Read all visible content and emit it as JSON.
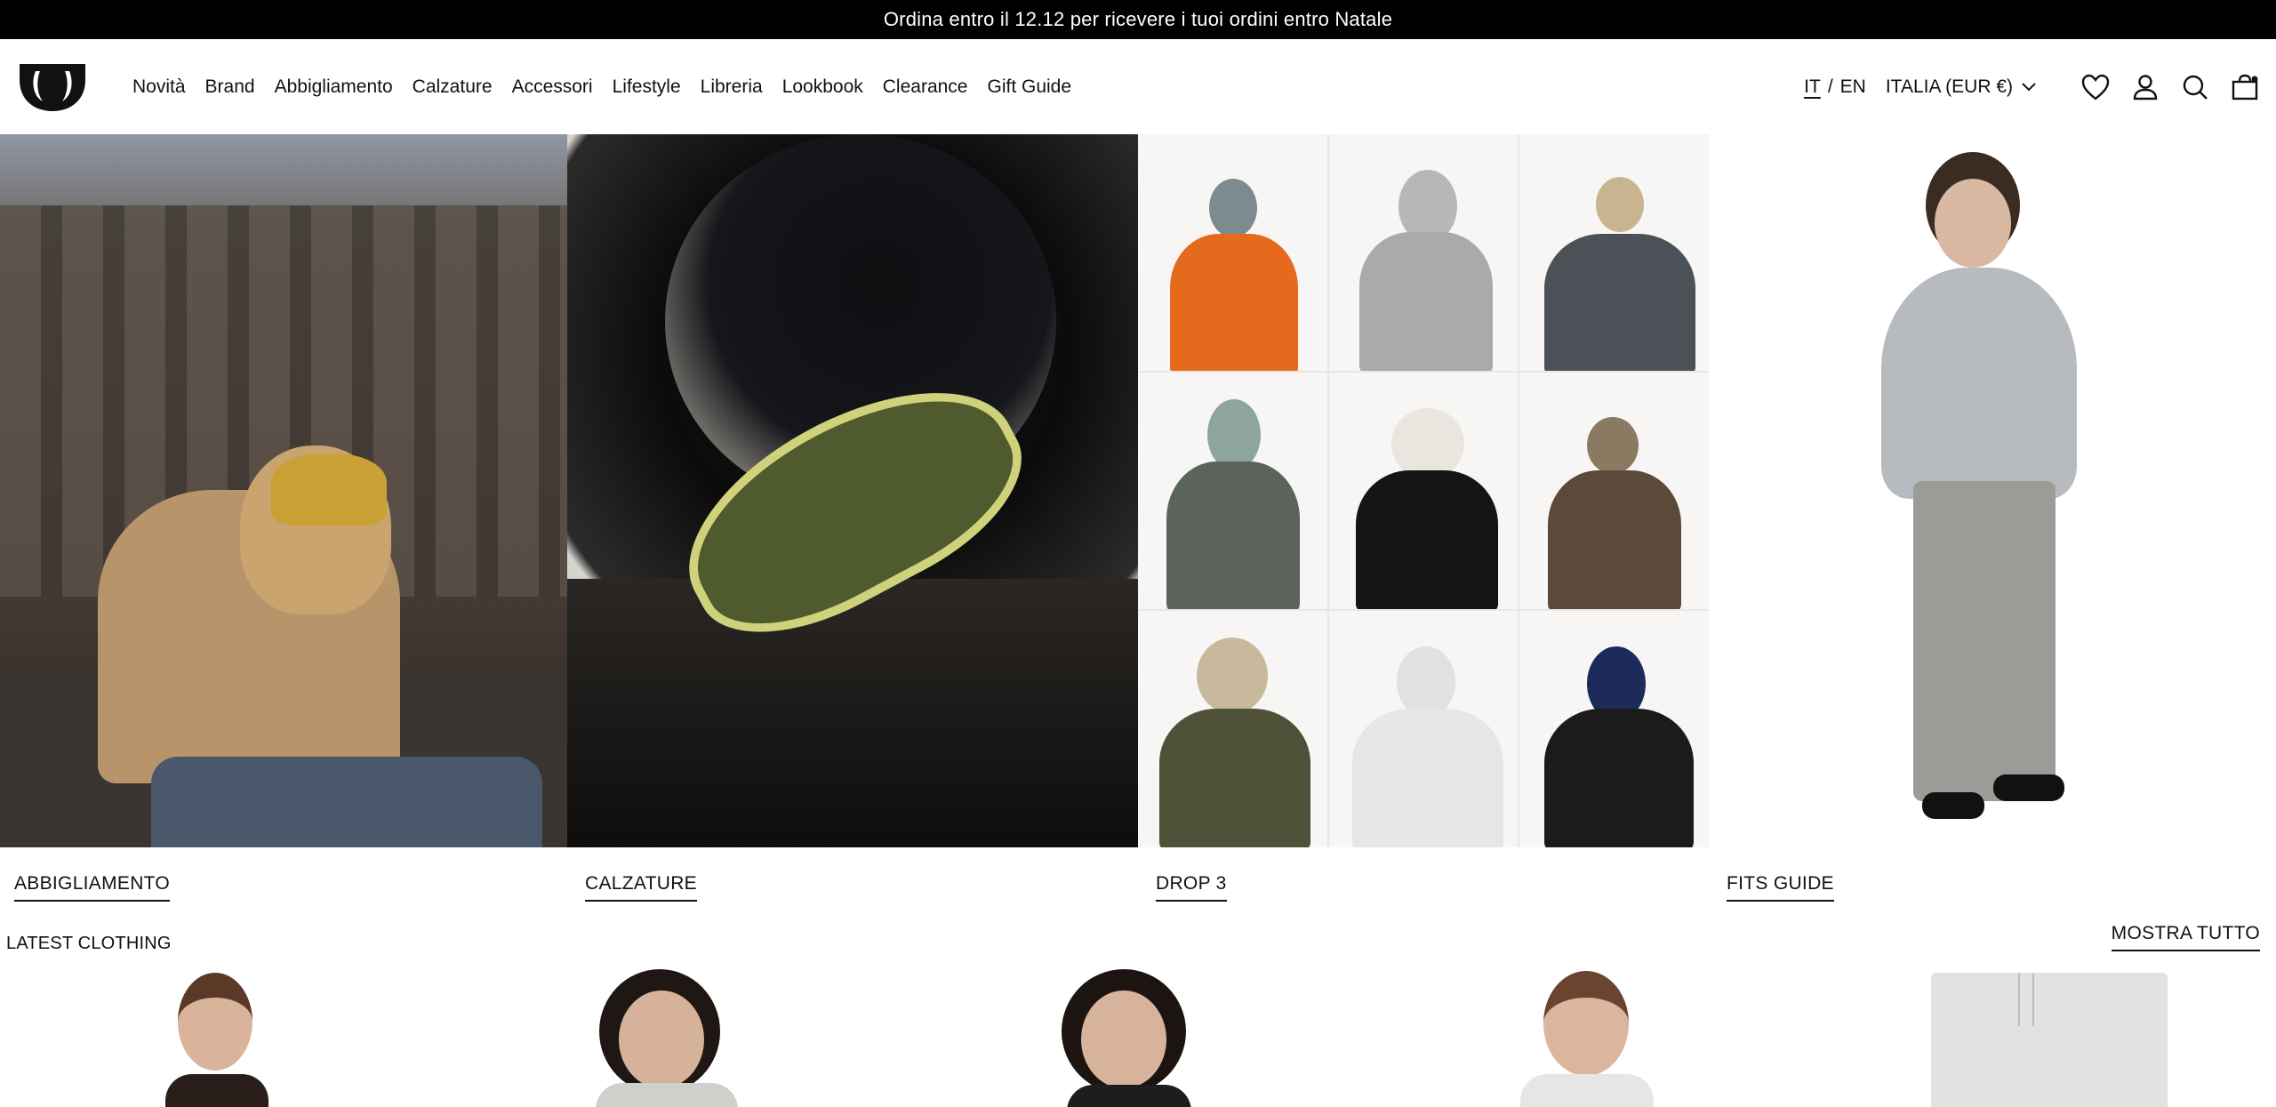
{
  "announcement": {
    "text": "Ordina entro il 12.12 per ricevere i tuoi ordini entro Natale"
  },
  "header": {
    "logo_icon": "brand-logo",
    "nav": [
      "Novità",
      "Brand",
      "Abbigliamento",
      "Calzature",
      "Accessori",
      "Lifestyle",
      "Libreria",
      "Lookbook",
      "Clearance",
      "Gift Guide"
    ],
    "lang": {
      "it": "IT",
      "sep": "/",
      "en": "EN"
    },
    "region": "ITALIA (EUR €)",
    "icons": [
      "heart-icon",
      "user-icon",
      "search-icon",
      "bag-icon"
    ]
  },
  "hero": {
    "panels": [
      "abbigliamento-photo",
      "calzature-photo",
      "drop-3-grid",
      "fits-guide-photo"
    ],
    "labels": [
      "ABBIGLIAMENTO",
      "CALZATURE",
      "DROP 3",
      "FITS GUIDE"
    ]
  },
  "latest": {
    "title": "LATEST CLOTHING",
    "show_all": "MOSTRA TUTTO"
  },
  "colors": {
    "announcement_bg": "#000000",
    "text": "#111111",
    "background": "#ffffff"
  }
}
